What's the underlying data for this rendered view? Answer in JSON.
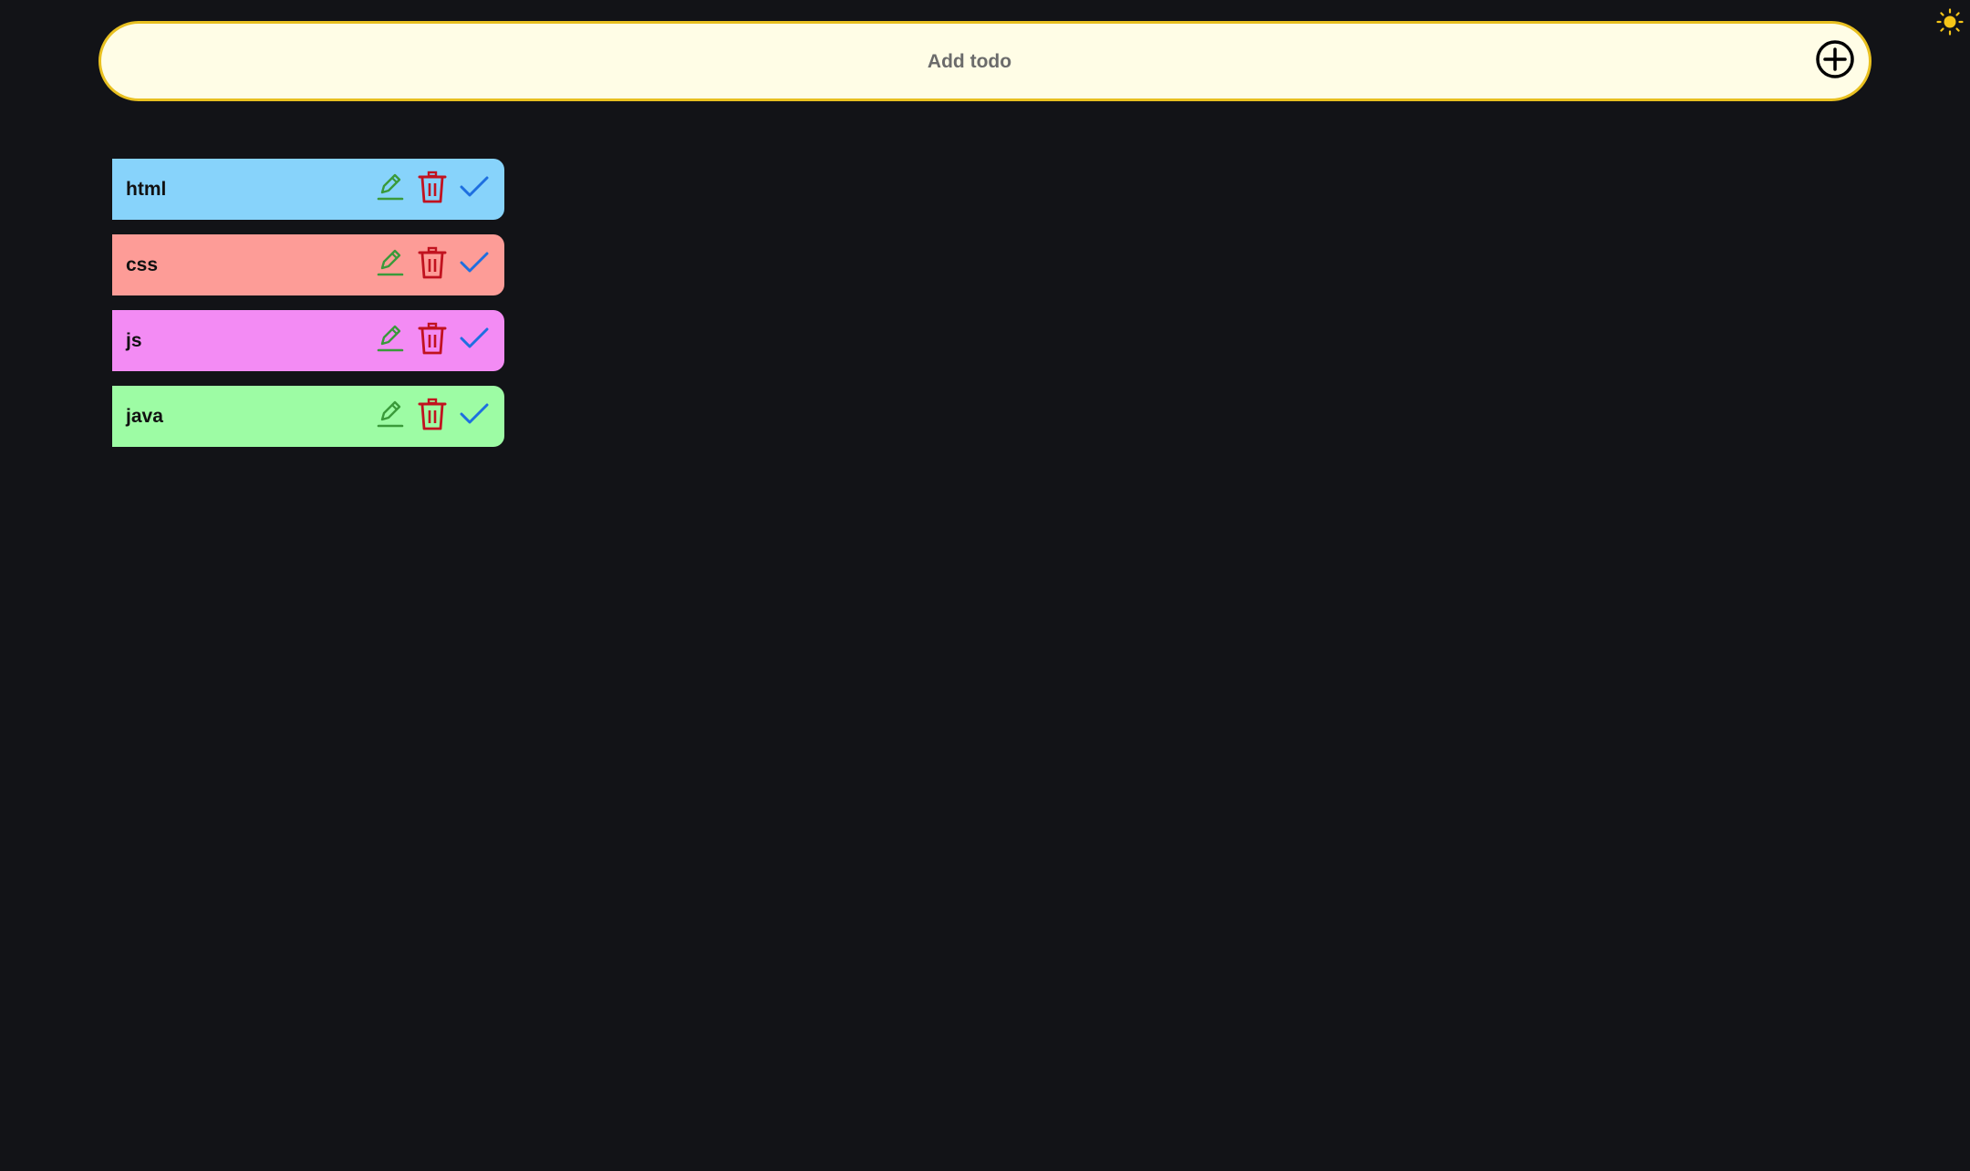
{
  "add_todo": {
    "placeholder": "Add todo",
    "value": ""
  },
  "theme_toggle": {
    "icon": "sun-icon",
    "color": "#f5c518"
  },
  "todos": [
    {
      "text": "html",
      "color": "#87d3fb"
    },
    {
      "text": "css",
      "color": "#fd9c97"
    },
    {
      "text": "js",
      "color": "#f38bf4"
    },
    {
      "text": "java",
      "color": "#9dfca4"
    }
  ],
  "action_colors": {
    "edit": "#3a9a3a",
    "delete": "#c1121f",
    "done": "#1e6fe0"
  }
}
